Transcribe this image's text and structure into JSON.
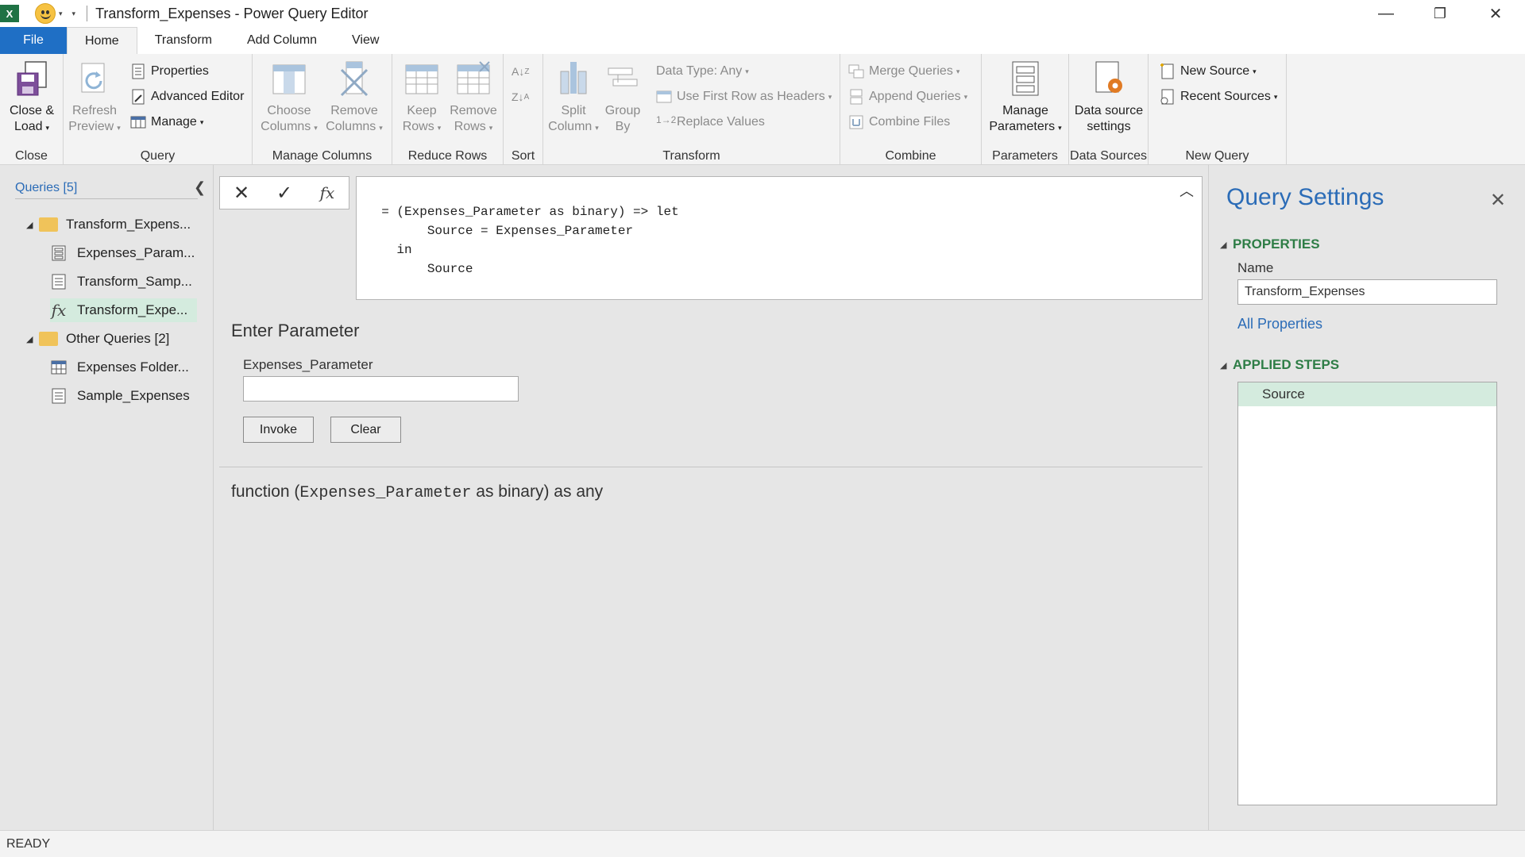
{
  "window": {
    "title": "Transform_Expenses - Power Query Editor",
    "minimize": "—",
    "restore": "❐",
    "close": "✕"
  },
  "tabs": [
    {
      "label": "File"
    },
    {
      "label": "Home"
    },
    {
      "label": "Transform"
    },
    {
      "label": "Add Column"
    },
    {
      "label": "View"
    }
  ],
  "ribbon": {
    "close_group": {
      "close_load": "Close &",
      "close_load2": "Load",
      "label": "Close"
    },
    "query_group": {
      "refresh": "Refresh",
      "refresh2": "Preview",
      "properties": "Properties",
      "advanced_editor": "Advanced Editor",
      "manage": "Manage",
      "label": "Query"
    },
    "manage_columns": {
      "choose": "Choose",
      "choose2": "Columns",
      "remove": "Remove",
      "remove2": "Columns",
      "label": "Manage Columns"
    },
    "reduce_rows": {
      "keep": "Keep",
      "keep2": "Rows",
      "remove": "Remove",
      "remove2": "Rows",
      "label": "Reduce Rows"
    },
    "sort": {
      "label": "Sort"
    },
    "transform": {
      "split": "Split",
      "split2": "Column",
      "group": "Group",
      "group2": "By",
      "data_type": "Data Type: Any",
      "first_row": "Use First Row as Headers",
      "replace": "Replace Values",
      "label": "Transform"
    },
    "combine": {
      "merge": "Merge Queries",
      "append": "Append Queries",
      "combine_files": "Combine Files",
      "label": "Combine"
    },
    "parameters": {
      "manage": "Manage",
      "manage2": "Parameters",
      "label": "Parameters"
    },
    "data_sources": {
      "settings": "Data source",
      "settings2": "settings",
      "label": "Data Sources"
    },
    "new_query": {
      "new_source": "New Source",
      "recent_sources": "Recent Sources",
      "label": "New Query"
    }
  },
  "queries": {
    "header": "Queries [5]",
    "items": [
      {
        "label": "Transform_Expens...",
        "type": "folder"
      },
      {
        "label": "Expenses_Param...",
        "type": "parameter"
      },
      {
        "label": "Transform_Samp...",
        "type": "table-doc"
      },
      {
        "label": "Transform_Expe...",
        "type": "function"
      },
      {
        "label": "Other Queries [2]",
        "type": "folder"
      },
      {
        "label": "Expenses Folder...",
        "type": "table"
      },
      {
        "label": "Sample_Expenses",
        "type": "table-doc"
      }
    ]
  },
  "formula": {
    "text": "= (Expenses_Parameter as binary) => let\n        Source = Expenses_Parameter\n    in\n        Source"
  },
  "invoke": {
    "heading": "Enter Parameter",
    "param_label": "Expenses_Parameter",
    "param_value": "",
    "invoke_label": "Invoke",
    "clear_label": "Clear",
    "sig_prefix": "function (",
    "sig_param": "Expenses_Parameter",
    "sig_suffix": " as binary) as any"
  },
  "settings": {
    "title": "Query Settings",
    "properties_head": "PROPERTIES",
    "name_label": "Name",
    "name_value": "Transform_Expenses",
    "all_properties": "All Properties",
    "steps_head": "APPLIED STEPS",
    "steps": [
      {
        "label": "Source"
      }
    ]
  },
  "status": {
    "text": "READY"
  },
  "colors": {
    "accent": "#1f6fc5",
    "selected": "#d4ebde",
    "section": "#2e7d46"
  }
}
